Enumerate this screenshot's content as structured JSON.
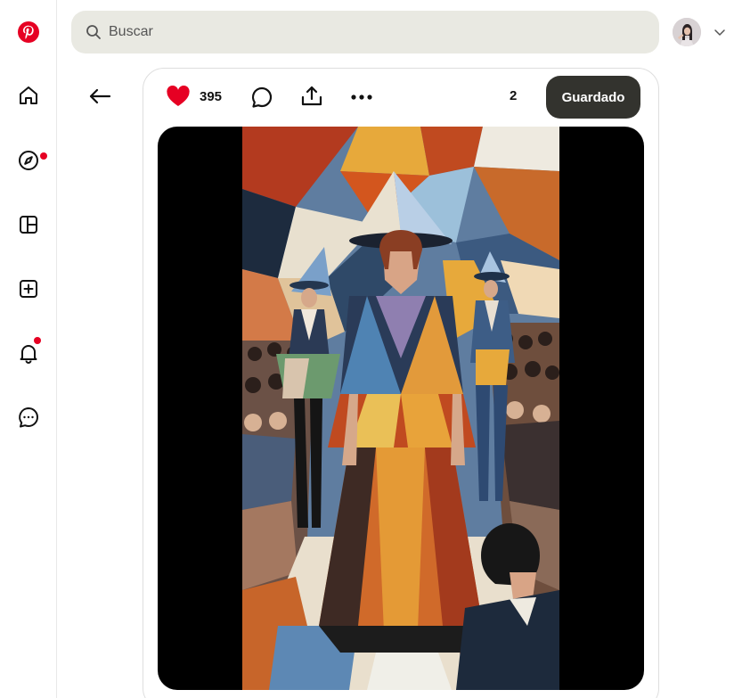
{
  "search": {
    "placeholder": "Buscar"
  },
  "rail": {
    "items": [
      {
        "name": "logo",
        "icon": "pinterest-logo-icon"
      },
      {
        "name": "home",
        "icon": "home-icon"
      },
      {
        "name": "explore",
        "icon": "compass-icon",
        "notification": true
      },
      {
        "name": "boards",
        "icon": "board-icon"
      },
      {
        "name": "create",
        "icon": "plus-square-icon"
      },
      {
        "name": "notifications",
        "icon": "bell-icon",
        "notification": true
      },
      {
        "name": "messages",
        "icon": "chat-icon"
      }
    ]
  },
  "pin": {
    "likes": "395",
    "save_count": "2",
    "save_label": "Guardado"
  },
  "colors": {
    "brand": "#e60023",
    "search_bg": "#e9e9e2",
    "save_button_bg": "#33332e",
    "heart": "#e60023"
  }
}
